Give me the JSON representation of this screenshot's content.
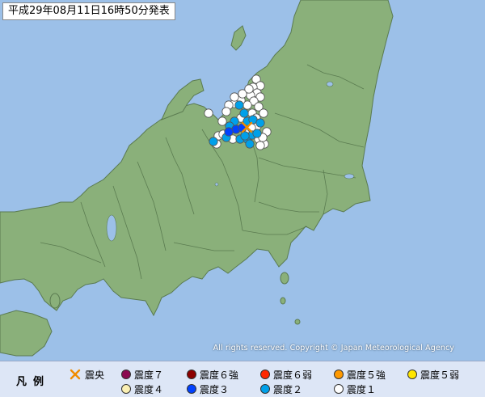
{
  "map": {
    "title": "平成29年08月11日16時50分発表",
    "copyright": "All rights reserved. Copyright © Japan Meteorological Agency",
    "colors": {
      "sea": "#9cc0e8",
      "land": "#8ab07a",
      "border": "#4f6f46",
      "lake": "#9cc0e8"
    },
    "epicenter": {
      "symbol": "×",
      "color": "#f08c00"
    },
    "intensity_colors": {
      "7": "#8b0a50",
      "6+": "#8c0000",
      "6-": "#ff2800",
      "5+": "#ff9900",
      "5-": "#ffe600",
      "4": "#faf0b4",
      "3": "#0041ff",
      "2": "#00a0e9",
      "1": "#ffffff"
    },
    "observations": [
      {
        "intensity": "3",
        "count": 3
      },
      {
        "intensity": "2",
        "count": 15
      },
      {
        "intensity": "1",
        "count": 34
      }
    ]
  },
  "legend": {
    "title": "凡例",
    "items": [
      {
        "label": "震央",
        "kind": "epicenter"
      },
      {
        "label": "震度７",
        "intensity": "7"
      },
      {
        "label": "震度６強",
        "intensity": "6+"
      },
      {
        "label": "震度６弱",
        "intensity": "6-"
      },
      {
        "label": "震度５強",
        "intensity": "5+"
      },
      {
        "label": "震度５弱",
        "intensity": "5-"
      },
      {
        "label": "震度４",
        "intensity": "4"
      },
      {
        "label": "震度３",
        "intensity": "3"
      },
      {
        "label": "震度２",
        "intensity": "2"
      },
      {
        "label": "震度１",
        "intensity": "1"
      }
    ]
  }
}
